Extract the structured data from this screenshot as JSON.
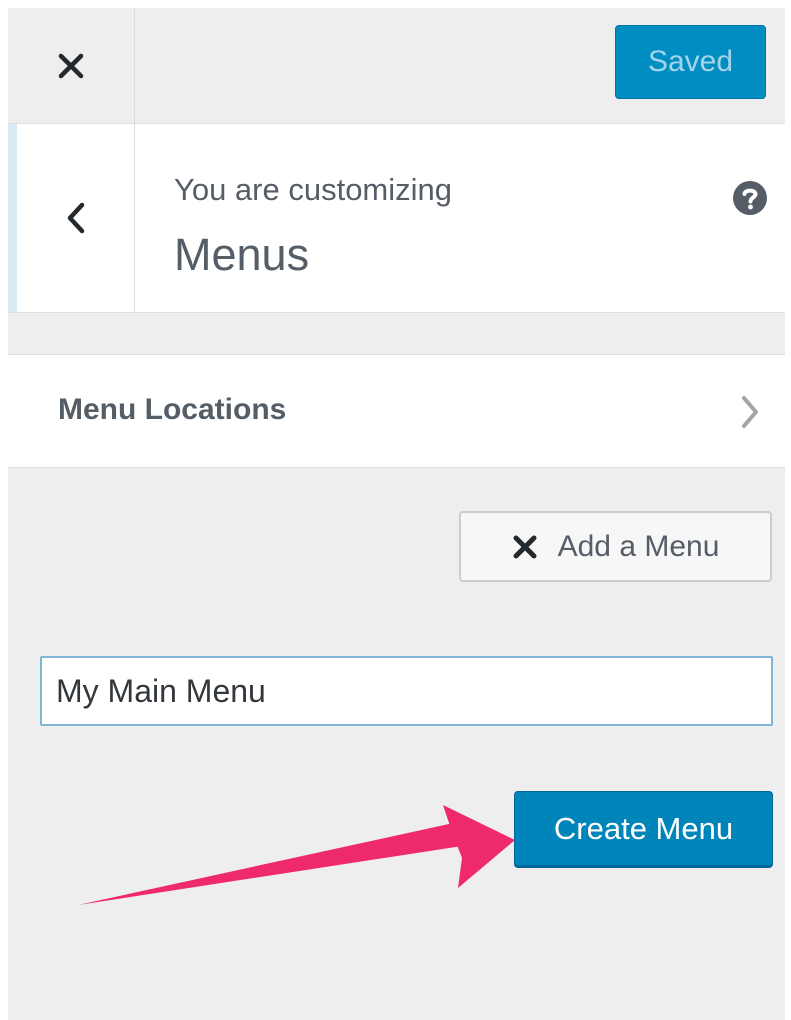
{
  "header": {
    "close_icon": "close-icon",
    "saved_label": "Saved"
  },
  "customizing": {
    "label": "You are customizing",
    "title": "Menus",
    "back_icon": "chevron-left-icon",
    "help_icon": "question-circle-icon",
    "settings_icon": "gear-icon"
  },
  "menu_locations": {
    "label": "Menu Locations",
    "icon": "chevron-right-icon"
  },
  "add_menu": {
    "label": "Add a Menu",
    "icon": "close-icon"
  },
  "new_menu": {
    "name_value": "My Main Menu",
    "create_label": "Create Menu"
  },
  "annotation": {
    "arrow_color": "#ee2a6b",
    "target": "create-menu-button"
  },
  "colors": {
    "primary": "#0085ba",
    "saved_bg": "#008ec2",
    "panel_bg": "#eeeeee"
  }
}
